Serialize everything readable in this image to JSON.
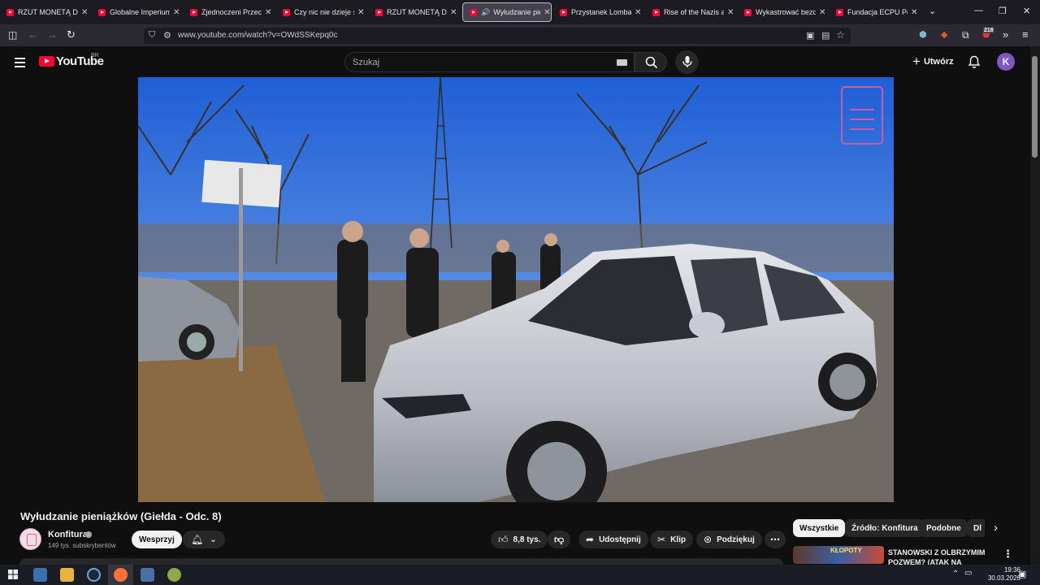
{
  "tabs": [
    {
      "label": "RZUT MONETĄ DECY"
    },
    {
      "label": "Globalne Imperium B"
    },
    {
      "label": "Zjednoczeni Przeciw"
    },
    {
      "label": "Czy nic nie dzieje się"
    },
    {
      "label": "RZUT MONETĄ DECY"
    },
    {
      "label": "Wyłudzanie pien"
    },
    {
      "label": "Przystanek Lombard"
    },
    {
      "label": "Rise of the Nazis and"
    },
    {
      "label": "Wykastrować bezdom"
    },
    {
      "label": "Fundacja ECPU Polsk"
    }
  ],
  "active_tab_index": 5,
  "address_bar": {
    "url": "www.youtube.com/watch?v=OWdSSKepq0c"
  },
  "extensions_badge": "218",
  "yt_header": {
    "logo_text": "YouTube",
    "region": "BR",
    "search_placeholder": "Szukaj",
    "create_label": "Utwórz",
    "avatar_letter": "K"
  },
  "video": {
    "title": "Wyłudzanie pieniążków (Giełda - Odc. 8)",
    "channel": "Konfitura",
    "subscribers": "149 tys. subskrybentów",
    "support_label": "Wesprzyj",
    "likes": "8,8 tys.",
    "share_label": "Udostępnij",
    "clip_label": "Klip",
    "thanks_label": "Podziękuj"
  },
  "filter_chips": [
    {
      "label": "Wszystkie"
    },
    {
      "label": "Źródło: Konfitura"
    },
    {
      "label": "Podobne"
    },
    {
      "label": "Dl"
    }
  ],
  "recommendation": {
    "thumb_text": "KŁOPOTY",
    "title": "STANOWSKI Z OLBRZYMIM POZWEM? (ATAK NA"
  },
  "taskbar": {
    "time": "19:36",
    "date": "30.03.2026"
  },
  "colors": {
    "yt_red": "#ff0033",
    "bg": "#0f0f0f",
    "avatar": "#7e57c2"
  }
}
